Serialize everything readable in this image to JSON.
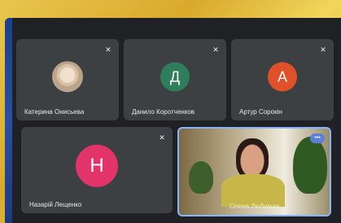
{
  "participants": [
    {
      "name": "Катерина Онисьева",
      "avatar_type": "photo"
    },
    {
      "name": "Данило Коротченков",
      "initial": "Д",
      "color": "#2e7d5b"
    },
    {
      "name": "Артур Сорокін",
      "initial": "А",
      "color": "#e0512a"
    },
    {
      "name": "Назарій Лещенко",
      "initial": "Н",
      "color": "#e2336b"
    },
    {
      "name": "Олена Любимая",
      "avatar_type": "video"
    }
  ],
  "icons": {
    "mic_off": "mic-off-icon",
    "more": "more-options-icon"
  },
  "accent_color": "#8ab4f8"
}
